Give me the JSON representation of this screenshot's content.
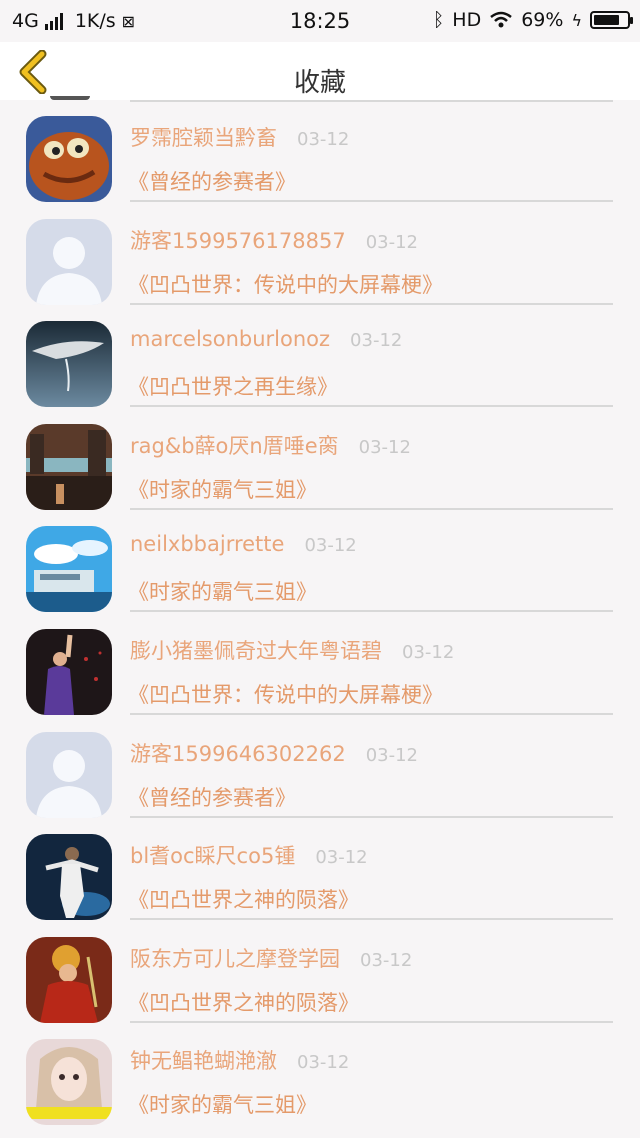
{
  "status_bar": {
    "network": "4G",
    "speed": "1K/s",
    "time": "18:25",
    "hd": "HD",
    "battery": "69%",
    "battery_level": 0.69
  },
  "header": {
    "title": "收藏"
  },
  "items": [
    {
      "name": "罗霈腔颖当黔畜",
      "date": "03-12",
      "work": "《曾经的参赛者》",
      "avatar": "cartoon-creature"
    },
    {
      "name": "游客1599576178857",
      "date": "03-12",
      "work": "《凹凸世界：传说中的大屏幕梗》",
      "avatar": "default"
    },
    {
      "name": "marcelsonburlonoz",
      "date": "03-12",
      "work": "《凹凸世界之再生缘》",
      "avatar": "hand-water"
    },
    {
      "name": "rag&b薛o厌n厝唾e脔",
      "date": "03-12",
      "work": "《时家的霸气三姐》",
      "avatar": "city"
    },
    {
      "name": "neilxbbajrrette",
      "date": "03-12",
      "work": "《时家的霸气三姐》",
      "avatar": "anime-sky"
    },
    {
      "name": "膨小猪墨佩奇过大年粤语碧",
      "date": "03-12",
      "work": "《凹凸世界：传说中的大屏幕梗》",
      "avatar": "performer"
    },
    {
      "name": "游客1599646302262",
      "date": "03-12",
      "work": "《曾经的参赛者》",
      "avatar": "default"
    },
    {
      "name": "bl耆oc睬尺co5锺",
      "date": "03-12",
      "work": "《凹凸世界之神的陨落》",
      "avatar": "dancer"
    },
    {
      "name": "阪东方可儿之摩登学园",
      "date": "03-12",
      "work": "《凹凸世界之神的陨落》",
      "avatar": "warrior"
    },
    {
      "name": "钟无鲳艳蝴滟澈",
      "date": "03-12",
      "work": "《时家的霸气三姐》",
      "avatar": "girl"
    }
  ],
  "colors": {
    "name": "#e9a57a",
    "work": "#e49a6a",
    "date": "#c8c8c8",
    "back": "#f0c020"
  }
}
